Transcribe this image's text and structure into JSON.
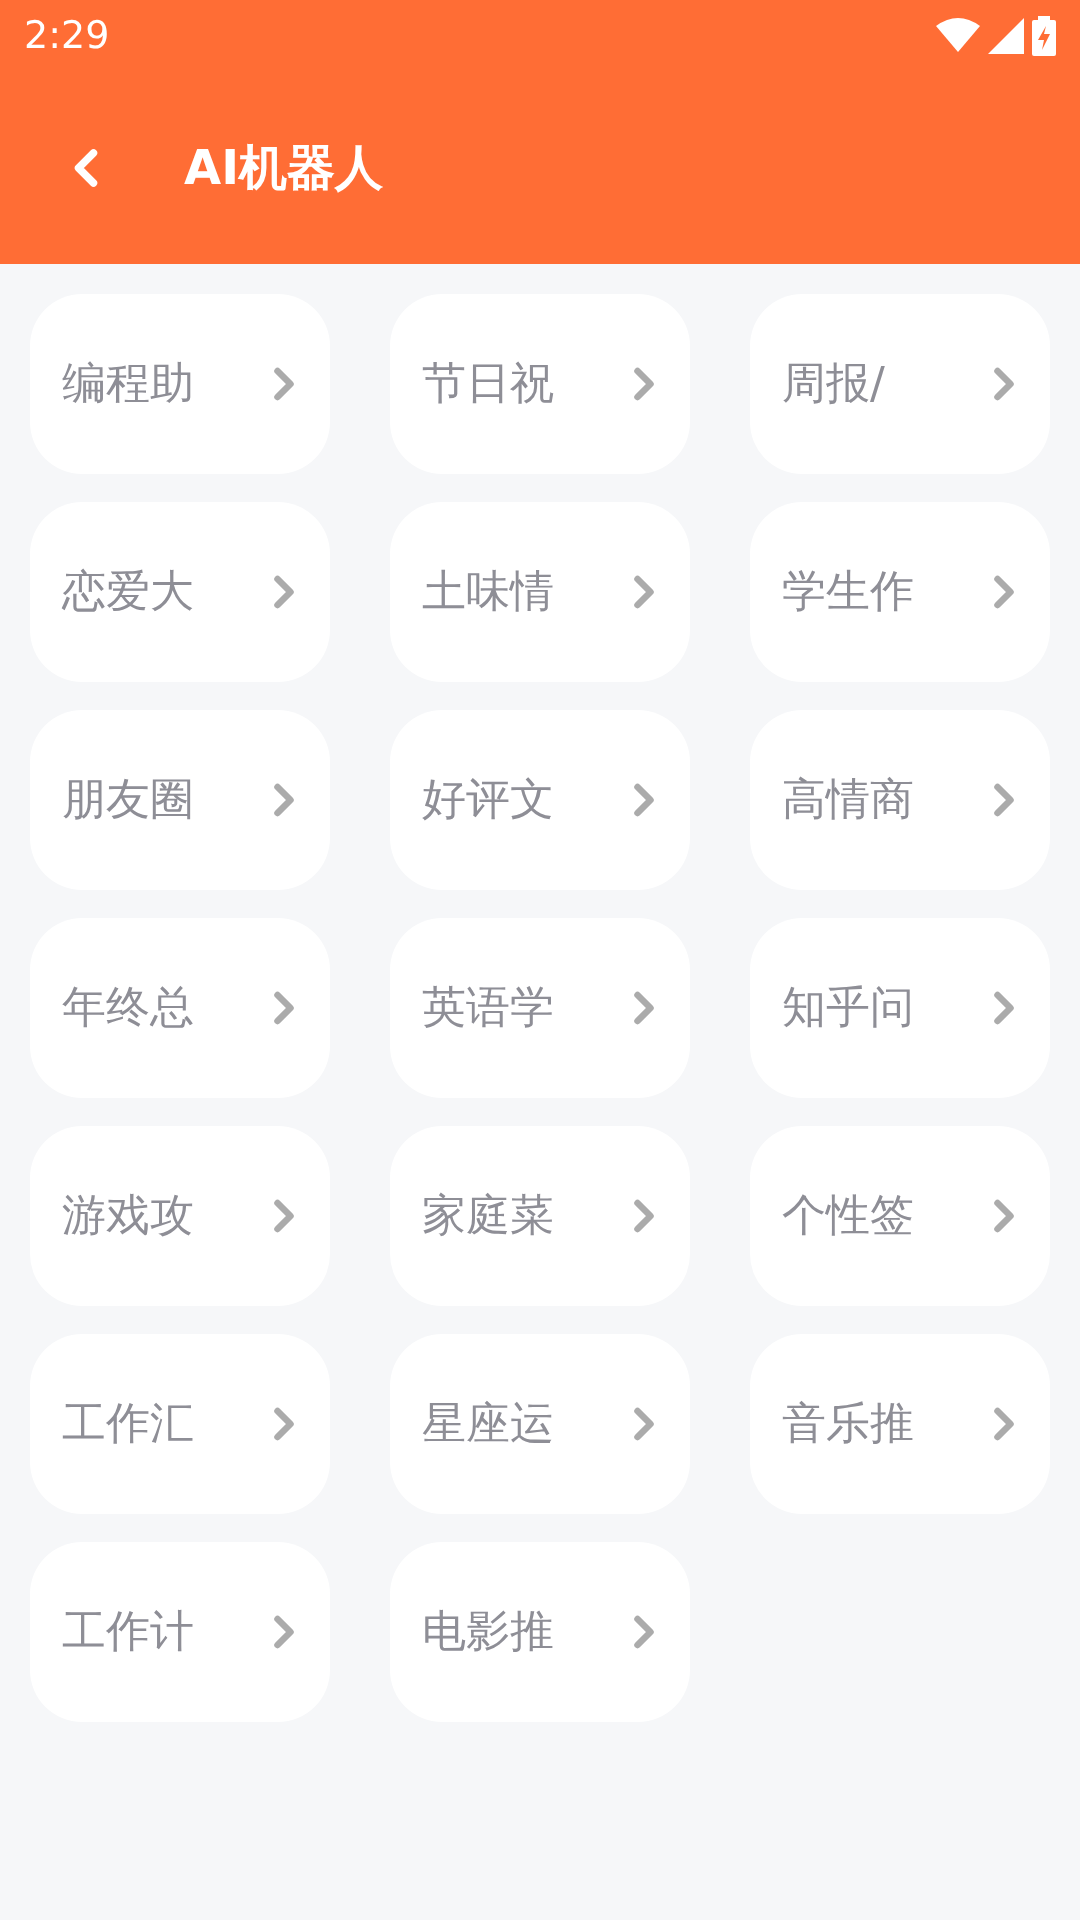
{
  "status_bar": {
    "time": "2:29"
  },
  "header": {
    "title": "AI机器人"
  },
  "cards": [
    {
      "label": "编程助"
    },
    {
      "label": "节日祝"
    },
    {
      "label": "周报/"
    },
    {
      "label": "恋爱大"
    },
    {
      "label": "土味情"
    },
    {
      "label": "学生作"
    },
    {
      "label": "朋友圈"
    },
    {
      "label": "好评文"
    },
    {
      "label": "高情商"
    },
    {
      "label": "年终总"
    },
    {
      "label": "英语学"
    },
    {
      "label": "知乎问"
    },
    {
      "label": "游戏攻"
    },
    {
      "label": "家庭菜"
    },
    {
      "label": "个性签"
    },
    {
      "label": "工作汇"
    },
    {
      "label": "星座运"
    },
    {
      "label": "音乐推"
    },
    {
      "label": "工作计"
    },
    {
      "label": "电影推"
    }
  ]
}
